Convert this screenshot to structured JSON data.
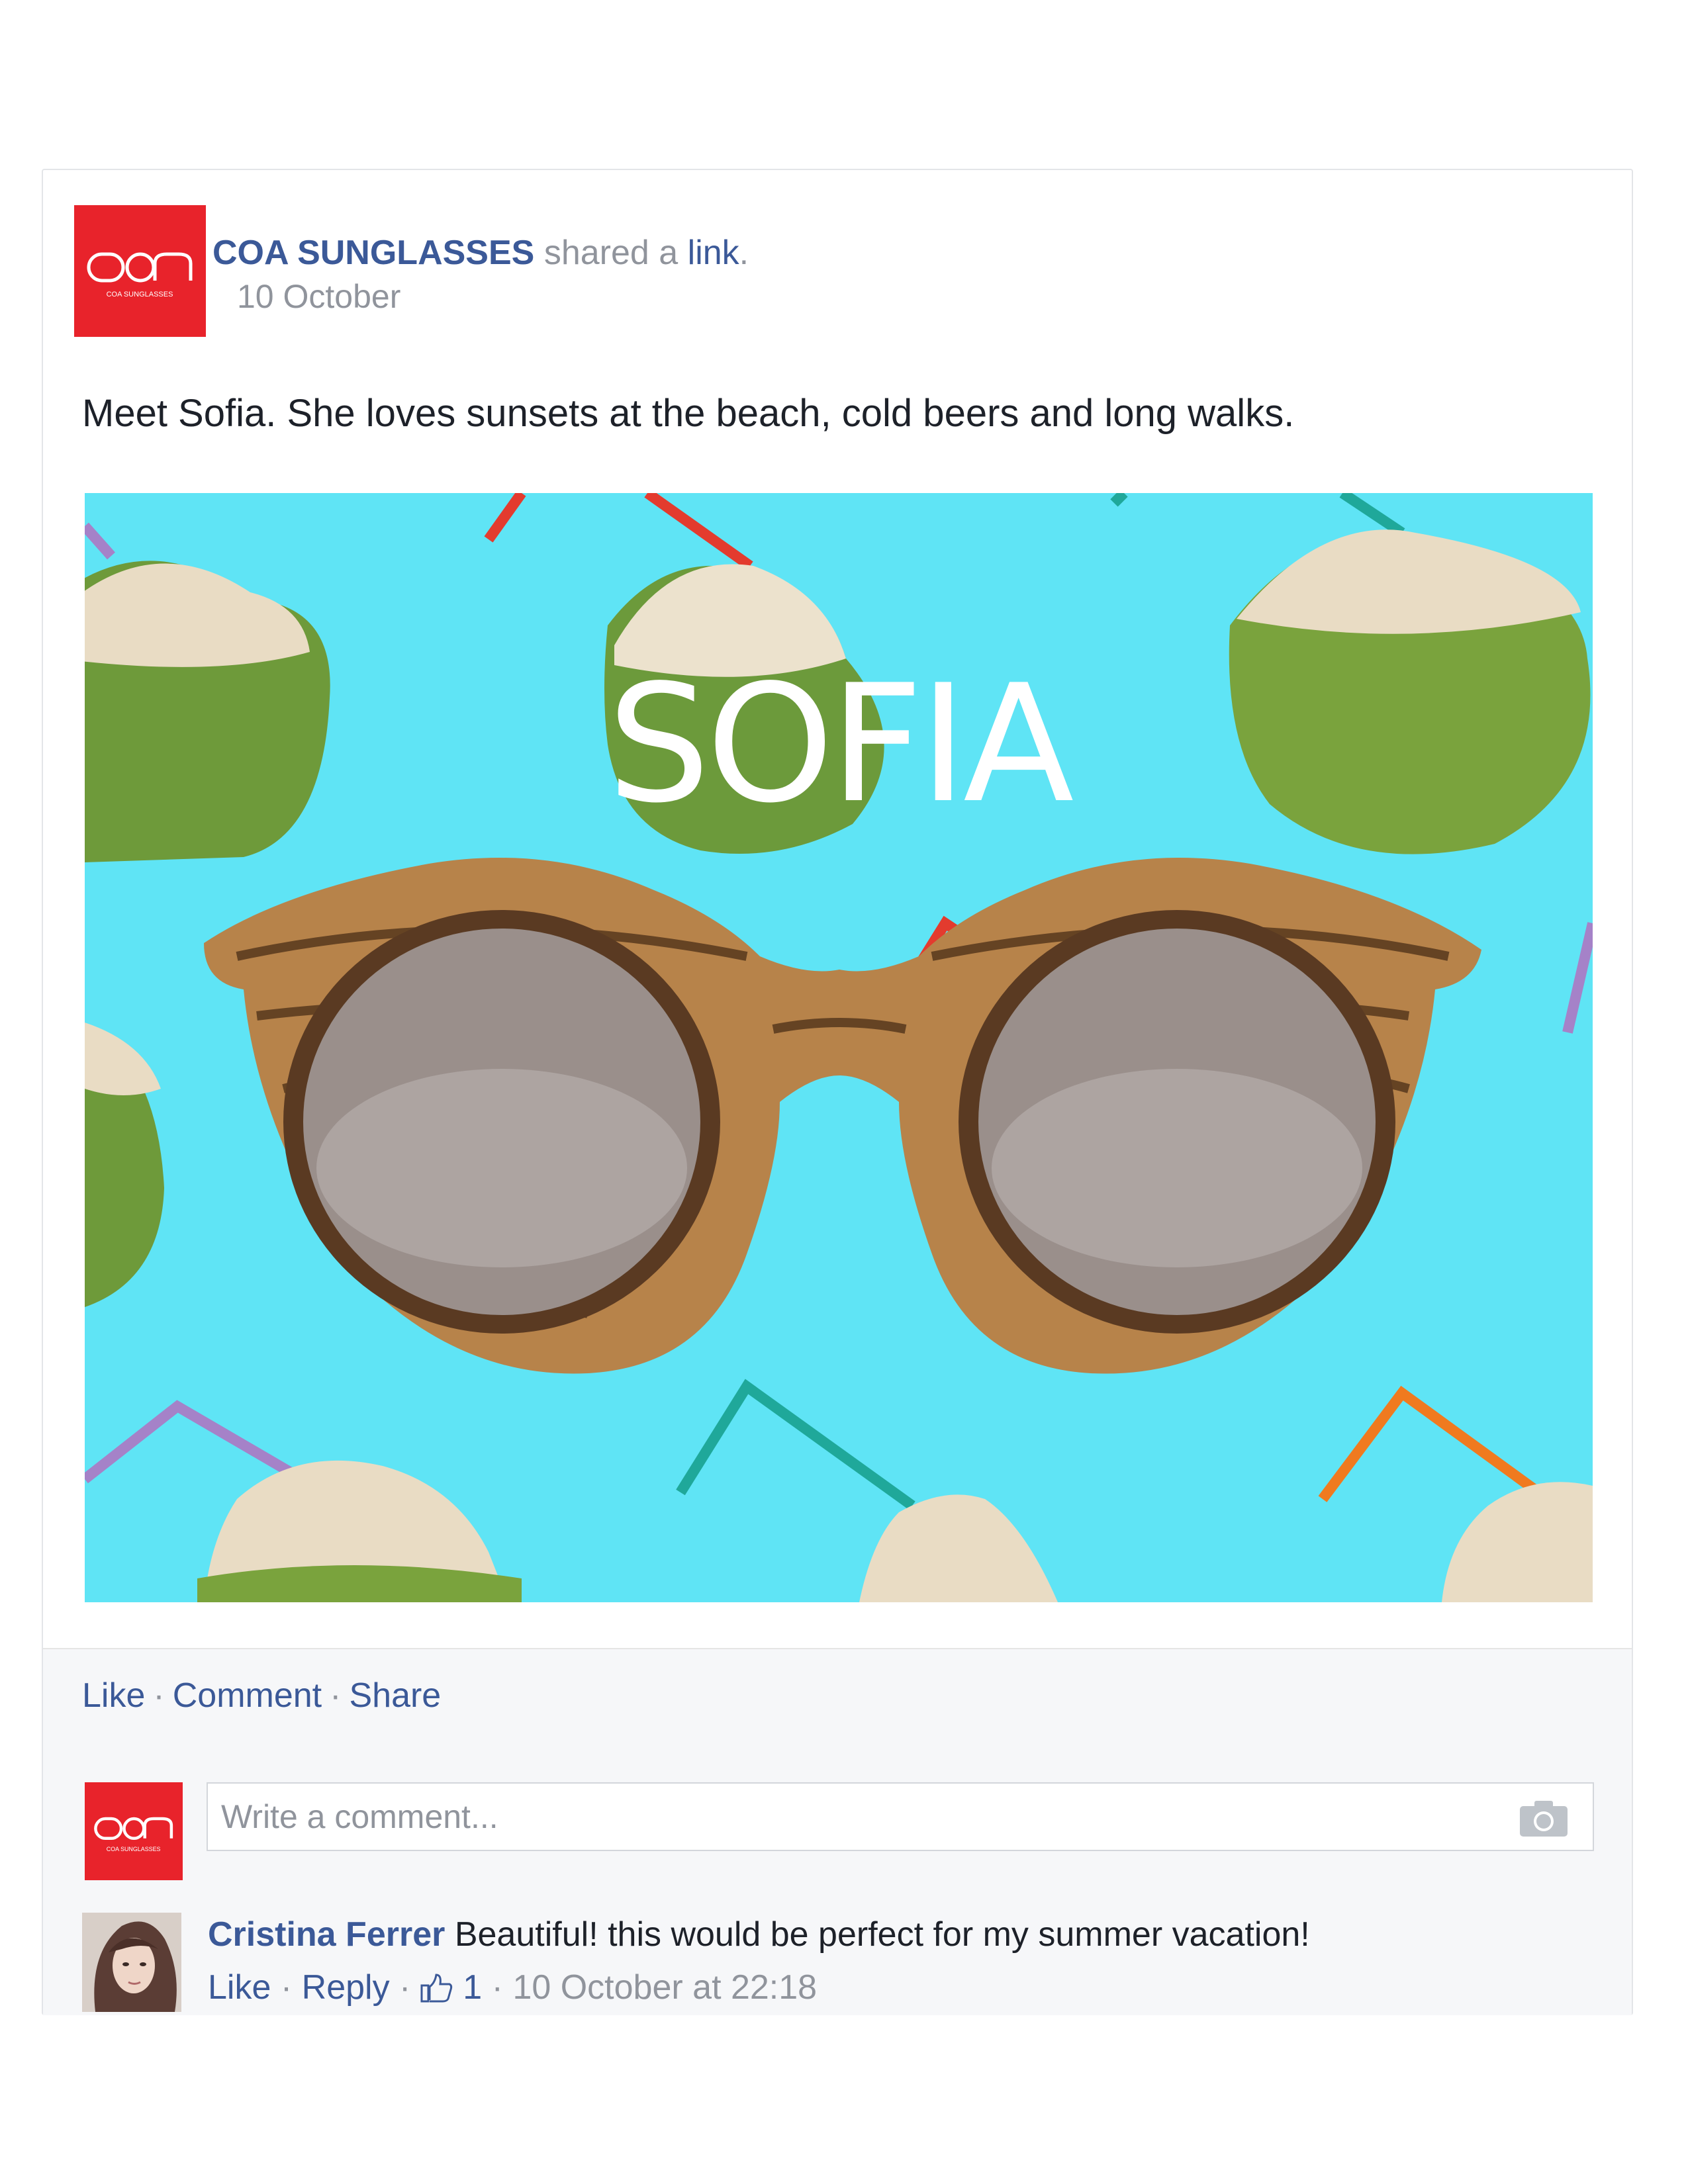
{
  "post": {
    "page_name": "COA SUNGLASSES",
    "shared_text": "shared a",
    "link_text": "link",
    "period": ".",
    "date": "10 October",
    "message": "Meet Sofia. She loves sunsets at the beach, cold beers and long walks.",
    "image_title": "SOFIA",
    "logo_text": "COA SUNGLASSES"
  },
  "actions": {
    "like": "Like",
    "comment": "Comment",
    "share": "Share",
    "separator": "·"
  },
  "comment_input": {
    "placeholder": "Write a comment..."
  },
  "comment": {
    "author": "Cristina Ferrer",
    "text": "Beautiful! this would be perfect for my summer vacation!",
    "like": "Like",
    "reply": "Reply",
    "separator": "·",
    "like_count": "1",
    "timestamp": "10 October at 22:18"
  },
  "colors": {
    "brand_red": "#e8232b",
    "link_blue": "#3b5998",
    "meta_gray": "#90949c",
    "image_background": "#5fe4f5"
  }
}
